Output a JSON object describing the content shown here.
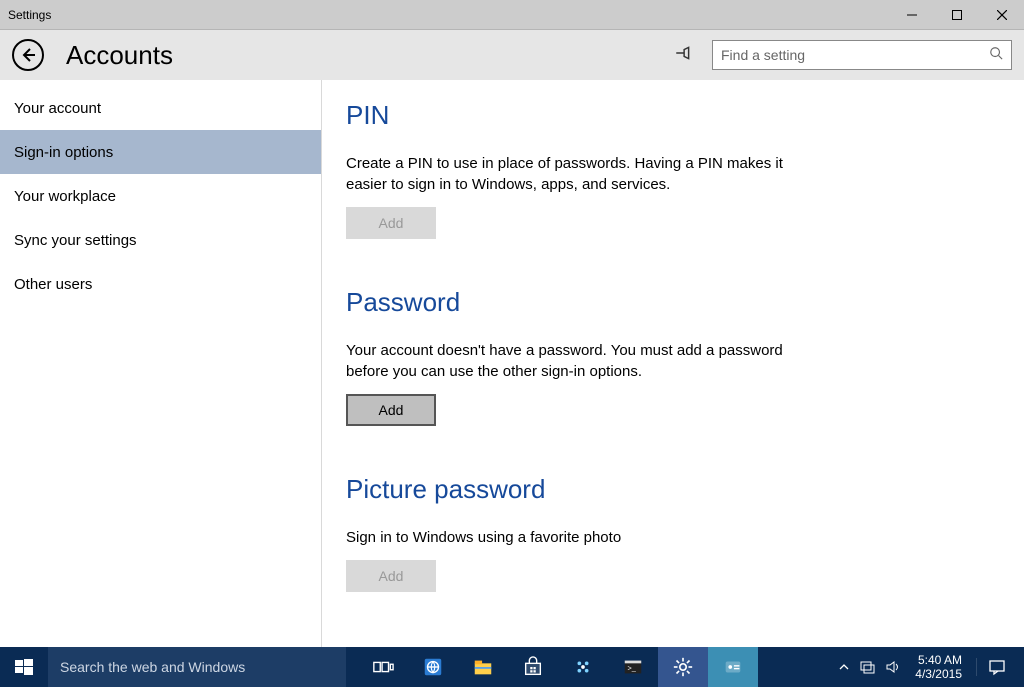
{
  "window": {
    "title": "Settings"
  },
  "header": {
    "page_title": "Accounts",
    "search_placeholder": "Find a setting"
  },
  "sidebar": {
    "items": [
      {
        "label": "Your account",
        "active": false
      },
      {
        "label": "Sign-in options",
        "active": true
      },
      {
        "label": "Your workplace",
        "active": false
      },
      {
        "label": "Sync your settings",
        "active": false
      },
      {
        "label": "Other users",
        "active": false
      }
    ]
  },
  "sections": {
    "pin": {
      "title": "PIN",
      "desc": "Create a PIN to use in place of passwords. Having a PIN makes it easier to sign in to Windows, apps, and services.",
      "button": "Add",
      "enabled": false
    },
    "password": {
      "title": "Password",
      "desc": "Your account doesn't have a password. You must add a password before you can use the other sign-in options.",
      "button": "Add",
      "enabled": true
    },
    "picture": {
      "title": "Picture password",
      "desc": "Sign in to Windows using a favorite photo",
      "button": "Add",
      "enabled": false
    }
  },
  "taskbar": {
    "search_placeholder": "Search the web and Windows",
    "time": "5:40 AM",
    "date": "4/3/2015"
  }
}
